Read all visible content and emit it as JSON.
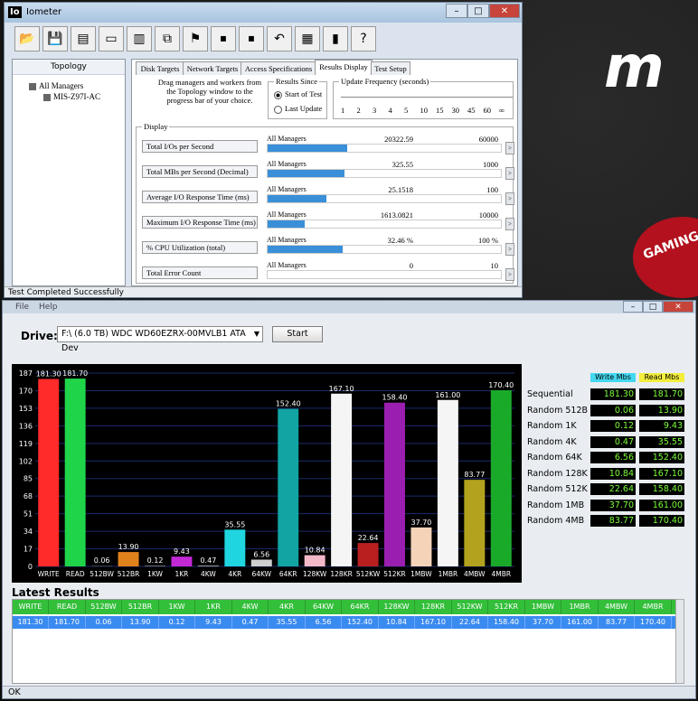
{
  "background": {
    "brand_text": "m",
    "badge_text": "GAMING"
  },
  "iometer": {
    "title": "Iometer",
    "logo": "Io",
    "window_controls": {
      "minimize": "–",
      "maximize": "□",
      "close": "✕"
    },
    "toolbar_icons": [
      "open-folder-icon",
      "save-icon",
      "display-icon",
      "worker-icon",
      "network-worker-icon",
      "disk-worker-icon",
      "duplicate-icon",
      "start-flag-icon",
      "stop-icon",
      "stop-all-icon",
      "reset-icon",
      "cpu-icon",
      "exit-icon",
      "help-icon"
    ],
    "toolbar_glyphs": [
      "📂",
      "💾",
      "▤",
      "▭",
      "▥",
      "⧉",
      "⚑",
      "⏹",
      "⏹",
      "↶",
      "▦",
      "▮",
      "?"
    ],
    "topology": {
      "header": "Topology",
      "root": "All Managers",
      "child": "MIS-Z97I-AC"
    },
    "tabs": [
      "Disk Targets",
      "Network Targets",
      "Access Specifications",
      "Results Display",
      "Test Setup"
    ],
    "active_tab": "Results Display",
    "instructions": "Drag managers and workers from the Topology window to the progress bar of your choice.",
    "results_since": {
      "legend": "Results Since",
      "options": [
        "Start of Test",
        "Last Update"
      ]
    },
    "update_frequency": {
      "legend": "Update Frequency (seconds)",
      "ticks": [
        "1",
        "2",
        "3",
        "4",
        "5",
        "10",
        "15",
        "30",
        "45",
        "60",
        "∞"
      ]
    },
    "display_legend": "Display",
    "metrics": [
      {
        "label": "Total I/Os per Second",
        "manager": "All Managers",
        "value": "20322.59",
        "max": "60000",
        "fill": 0.34
      },
      {
        "label": "Total MBs per Second (Decimal)",
        "manager": "All Managers",
        "value": "325.55",
        "max": "1000",
        "fill": 0.33
      },
      {
        "label": "Average I/O Response Time (ms)",
        "manager": "All Managers",
        "value": "25.1518",
        "max": "100",
        "fill": 0.25
      },
      {
        "label": "Maximum I/O Response Time (ms)",
        "manager": "All Managers",
        "value": "1613.0821",
        "max": "10000",
        "fill": 0.16
      },
      {
        "label": "% CPU Utilization (total)",
        "manager": "All Managers",
        "value": "32.46 %",
        "max": "100 %",
        "fill": 0.32
      },
      {
        "label": "Total Error Count",
        "manager": "All Managers",
        "value": "0",
        "max": "10",
        "fill": 0
      }
    ],
    "status": "Test Completed Successfully"
  },
  "benchmark": {
    "menu": [
      "File",
      "Help"
    ],
    "drive_label": "Drive:",
    "drive_value": "F:\\ (6.0 TB) WDC WD60EZRX-00MVLB1 ATA Dev",
    "start_label": "Start",
    "side_headers": {
      "write": "Write Mbs",
      "read": "Read Mbs"
    },
    "side_rows": [
      {
        "label": "Sequential",
        "write": "181.30",
        "read": "181.70"
      },
      {
        "label": "Random 512B",
        "write": "0.06",
        "read": "13.90"
      },
      {
        "label": "Random 1K",
        "write": "0.12",
        "read": "9.43"
      },
      {
        "label": "Random 4K",
        "write": "0.47",
        "read": "35.55"
      },
      {
        "label": "Random 64K",
        "write": "6.56",
        "read": "152.40"
      },
      {
        "label": "Random 128K",
        "write": "10.84",
        "read": "167.10"
      },
      {
        "label": "Random 512K",
        "write": "22.64",
        "read": "158.40"
      },
      {
        "label": "Random 1MB",
        "write": "37.70",
        "read": "161.00"
      },
      {
        "label": "Random 4MB",
        "write": "83.77",
        "read": "170.40"
      }
    ],
    "latest_title": "Latest Results",
    "table_headers": [
      "WRITE",
      "READ",
      "512BW",
      "512BR",
      "1KW",
      "1KR",
      "4KW",
      "4KR",
      "64KW",
      "64KR",
      "128KW",
      "128KR",
      "512KW",
      "512KR",
      "1MBW",
      "1MBR",
      "4MBW",
      "4MBR"
    ],
    "table_row": [
      "181.30",
      "181.70",
      "0.06",
      "13.90",
      "0.12",
      "9.43",
      "0.47",
      "35.55",
      "6.56",
      "152.40",
      "10.84",
      "167.10",
      "22.64",
      "158.40",
      "37.70",
      "161.00",
      "83.77",
      "170.40"
    ],
    "status": "OK"
  },
  "chart_data": {
    "type": "bar",
    "categories": [
      "WRITE",
      "READ",
      "512BW",
      "512BR",
      "1KW",
      "1KR",
      "4KW",
      "4KR",
      "64KW",
      "64KR",
      "128KW",
      "128KR",
      "512KW",
      "512KR",
      "1MBW",
      "1MBR",
      "4MBW",
      "4MBR"
    ],
    "values": [
      181.3,
      181.7,
      0.06,
      13.9,
      0.12,
      9.43,
      0.47,
      35.55,
      6.56,
      152.4,
      10.84,
      167.1,
      22.64,
      158.4,
      37.7,
      161.0,
      83.77,
      170.4
    ],
    "value_labels": [
      "181.30",
      "181.70",
      "0.06",
      "13.90",
      "0.12",
      "9.43",
      "0.47",
      "35.55",
      "6.56",
      "152.40",
      "10.84",
      "167.10",
      "22.64",
      "158.40",
      "37.70",
      "161.00",
      "83.77",
      "170.40"
    ],
    "colors": [
      "#ff2a2a",
      "#20d44a",
      "#3a3a3a",
      "#e0821c",
      "#6a6a6a",
      "#c32ad6",
      "#9a9a9a",
      "#1fd6e0",
      "#cfcfcf",
      "#12a3a3",
      "#f2b8c8",
      "#f5f5f5",
      "#b82020",
      "#9a1fb0",
      "#f5d3b8",
      "#f5f5f5",
      "#b3a21d",
      "#1aaa2a"
    ],
    "ylim": [
      0,
      187
    ],
    "yticks": [
      "187",
      "170",
      "153",
      "136",
      "119",
      "102",
      "85",
      "68",
      "51",
      "34",
      "17",
      "0"
    ],
    "grid": true
  }
}
